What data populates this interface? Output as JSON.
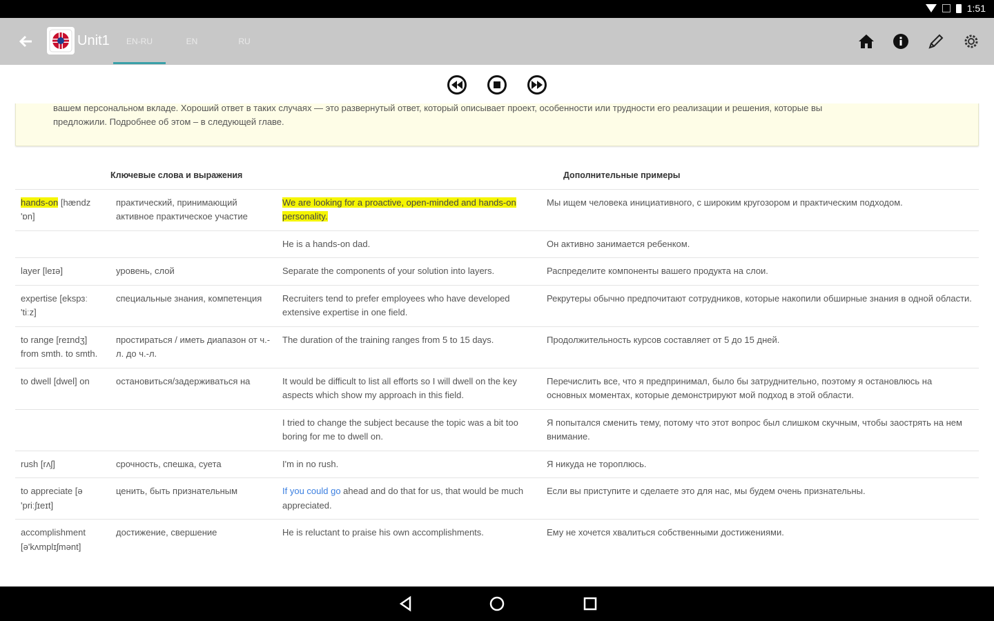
{
  "status_bar": {
    "time": "1:51"
  },
  "toolbar": {
    "title": "Unit1",
    "tabs": [
      {
        "label": "EN-RU",
        "active": true
      },
      {
        "label": "EN",
        "active": false
      },
      {
        "label": "RU",
        "active": false
      }
    ],
    "actions": [
      "home-icon",
      "info-icon",
      "pencil-icon",
      "gear-icon"
    ]
  },
  "media": {
    "buttons": [
      "rewind-icon",
      "stop-icon",
      "fast-forward-icon"
    ]
  },
  "note": {
    "line1": "вашем персональном вкладе. Хороший ответ в таких случаях — это развернутый ответ, который описывает проект, особенности или трудности его реализации и решения, которые вы",
    "line2": "предложили. Подробнее об этом – в следующей главе."
  },
  "table": {
    "headers": {
      "col1": "Ключевые слова и выражения",
      "col3": "Дополнительные примеры"
    },
    "rows": [
      {
        "term_hl": "hands-on",
        "term": " [hændz 'ɒn]",
        "meaning": "практический, принимающий активное практическое участие",
        "example_hl": "We are looking for a proactive, open-minded and hands-on personality.",
        "example": "",
        "translation": "Мы ищем человека инициативного, с широким кругозором и практическим подходом."
      },
      {
        "term": "",
        "meaning": "",
        "example": "He is a hands-on dad.",
        "translation": "Он активно занимается ребенком."
      },
      {
        "term": "layer [leɪə]",
        "meaning": "уровень, слой",
        "example": "Separate the components of your solution into layers.",
        "translation": "Распределите компоненты вашего продукта на слои."
      },
      {
        "term": "expertise [ekspɜː 'tiːz]",
        "meaning": "специальные знания, компетенция",
        "example": "Recruiters tend to prefer employees who have developed extensive expertise in one field.",
        "translation": "Рекрутеры обычно предпочитают сотрудников, которые накопили обширные знания в одной области."
      },
      {
        "term": "to range [reɪndʒ] from smth. to smth.",
        "meaning": "простираться / иметь диапазон от ч.-л. до ч.-л.",
        "example": "The duration of the training ranges from 5 to 15 days.",
        "translation": "Продолжительность курсов составляет от 5 до 15 дней."
      },
      {
        "term": "to dwell [dwel] on",
        "meaning": "остановиться/задерживаться на",
        "example": "It would be difficult to list all efforts so I will dwell on the key aspects which show my approach in this field.",
        "translation": "Перечислить все, что я предпринимал, было бы затруднительно, поэтому я остановлюсь на основных моментах, которые демонстрируют мой подход в этой области."
      },
      {
        "term": "",
        "meaning": "",
        "example": "I tried to change the subject because the topic was a bit too boring for me to dwell on.",
        "translation": "Я попытался сменить тему, потому что этот вопрос был слишком скучным, чтобы заострять на нем внимание."
      },
      {
        "term": "rush [rʌʃ]",
        "meaning": "срочность, спешка, суета",
        "example": "I'm in no rush.",
        "translation": "Я никуда не тороплюсь."
      },
      {
        "term": "to appreciate [ə 'priːʃɪeɪt]",
        "meaning": "ценить, быть признательным",
        "example_link": "If you could go",
        "example": " ahead and do that for us, that would be much appreciated.",
        "translation": "Если вы приступите и сделаете это для нас, мы будем очень признательны."
      },
      {
        "term": "accomplishment [ə'kʌmplɪʃmənt]",
        "meaning": "достижение, свершение",
        "example": "He is reluctant to praise his own accomplishments.",
        "translation": "Ему не хочется хвалиться собственными достижениями."
      }
    ]
  },
  "navbar": {
    "buttons": [
      "back-nav-icon",
      "home-nav-icon",
      "recents-nav-icon"
    ]
  }
}
